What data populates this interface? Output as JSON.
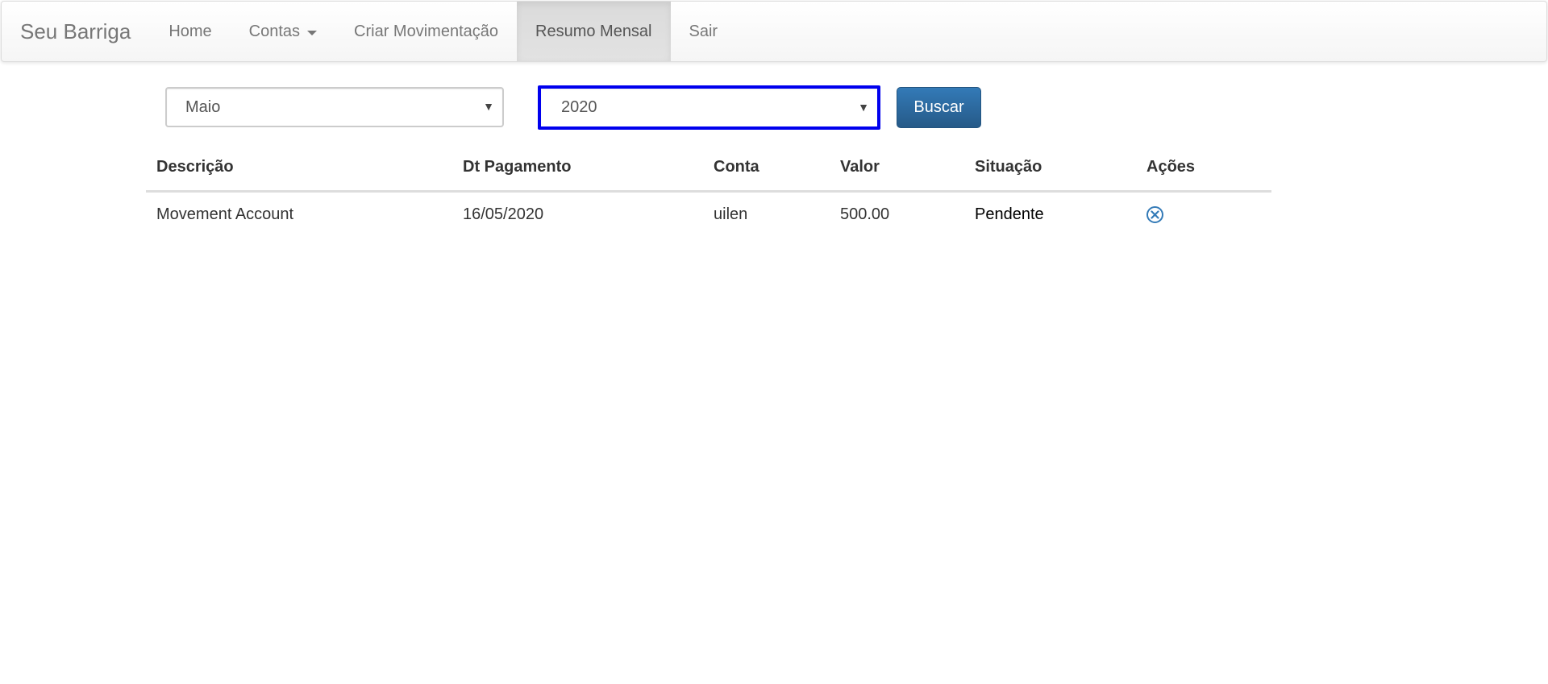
{
  "navbar": {
    "brand": "Seu Barriga",
    "items": [
      {
        "label": "Home"
      },
      {
        "label": "Contas"
      },
      {
        "label": "Criar Movimentação"
      },
      {
        "label": "Resumo Mensal"
      },
      {
        "label": "Sair"
      }
    ]
  },
  "filters": {
    "month": "Maio",
    "year": "2020",
    "search_label": "Buscar"
  },
  "table": {
    "headers": [
      "Descrição",
      "Dt Pagamento",
      "Conta",
      "Valor",
      "Situação",
      "Ações"
    ],
    "rows": [
      {
        "descricao": "Movement Account",
        "dt_pagamento": "16/05/2020",
        "conta": "uilen",
        "valor": "500.00",
        "situacao": "Pendente",
        "action_icon": "remove-circle-icon"
      }
    ]
  },
  "colors": {
    "primary": "#337ab7",
    "focus_outline": "#0000ee",
    "nav_active_bg": "#dbdbdb"
  }
}
